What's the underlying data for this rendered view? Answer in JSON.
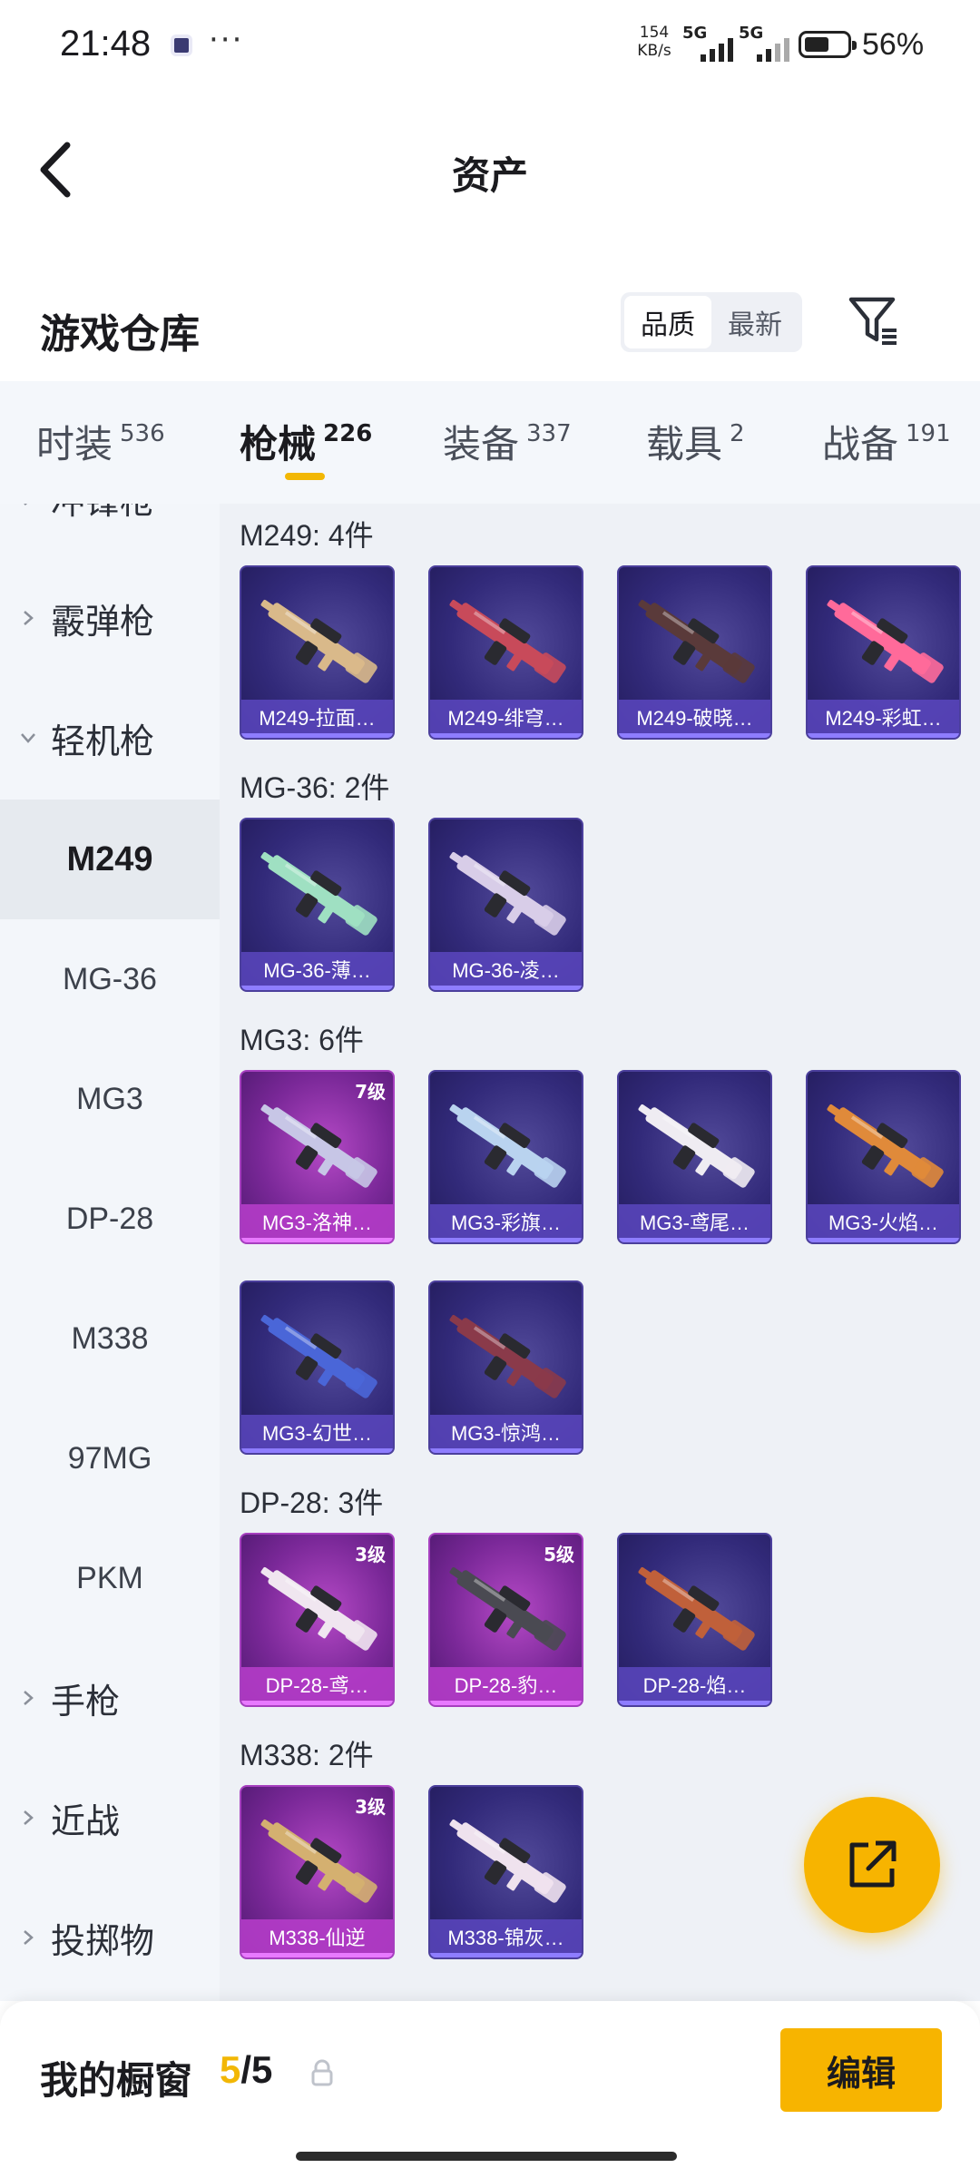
{
  "status_bar": {
    "time": "21:48",
    "dots": "···",
    "net_speed_value": "154",
    "net_speed_unit": "KB/s",
    "sig1_label": "5G",
    "sig2_label": "5G",
    "battery_level": 0.56,
    "battery_percent": "56%"
  },
  "header": {
    "title": "资产"
  },
  "warehouse": {
    "title": "游戏仓库",
    "sort_quality": "品质",
    "sort_newest": "最新"
  },
  "tabs": [
    {
      "label": "时装",
      "count": "536"
    },
    {
      "label": "枪械",
      "count": "226"
    },
    {
      "label": "装备",
      "count": "337"
    },
    {
      "label": "载具",
      "count": "2"
    },
    {
      "label": "战备",
      "count": "191"
    }
  ],
  "sidebar": {
    "items": [
      {
        "label": "冲锋枪"
      },
      {
        "label": "霰弹枪"
      },
      {
        "label": "轻机枪"
      },
      {
        "label": "M249"
      },
      {
        "label": "MG-36"
      },
      {
        "label": "MG3"
      },
      {
        "label": "DP-28"
      },
      {
        "label": "M338"
      },
      {
        "label": "97MG"
      },
      {
        "label": "PKM"
      },
      {
        "label": "手枪"
      },
      {
        "label": "近战"
      },
      {
        "label": "投掷物"
      }
    ]
  },
  "groups": [
    {
      "title": "M249: 4件",
      "items": [
        {
          "name": "M249-拉面…",
          "level": "",
          "gun_color": "#d9b98a"
        },
        {
          "name": "M249-绯穹…",
          "level": "",
          "gun_color": "#c84a5a"
        },
        {
          "name": "M249-破晓…",
          "level": "",
          "gun_color": "#5a3a3a"
        },
        {
          "name": "M249-彩虹…",
          "level": "",
          "gun_color": "#ff6a9a"
        }
      ]
    },
    {
      "title": "MG-36: 2件",
      "items": [
        {
          "name": "MG-36-薄…",
          "level": "",
          "gun_color": "#9fe0c2"
        },
        {
          "name": "MG-36-凌…",
          "level": "",
          "gun_color": "#d8cde8"
        }
      ]
    },
    {
      "title": "MG3: 6件",
      "items": [
        {
          "name": "MG3-洛神…",
          "level": "7级",
          "gun_color": "#c7c6e6"
        },
        {
          "name": "MG3-彩旗…",
          "level": "",
          "gun_color": "#b9d3ef"
        },
        {
          "name": "MG3-鸢尾…",
          "level": "",
          "gun_color": "#efecf2"
        },
        {
          "name": "MG3-火焰…",
          "level": "",
          "gun_color": "#e08a3a"
        },
        {
          "name": "MG3-幻世…",
          "level": "",
          "gun_color": "#4a66d8"
        },
        {
          "name": "MG3-惊鸿…",
          "level": "",
          "gun_color": "#8a3a4a"
        }
      ]
    },
    {
      "title": "DP-28: 3件",
      "items": [
        {
          "name": "DP-28-鸢…",
          "level": "3级",
          "gun_color": "#f0e6f0"
        },
        {
          "name": "DP-28-豹…",
          "level": "5级",
          "gun_color": "#4a4a52"
        },
        {
          "name": "DP-28-焰…",
          "level": "",
          "gun_color": "#c0603a"
        }
      ]
    },
    {
      "title": "M338: 2件",
      "items": [
        {
          "name": "M338-仙逆",
          "level": "3级",
          "gun_color": "#d4b070"
        },
        {
          "name": "M338-锦灰…",
          "level": "",
          "gun_color": "#efe2ee"
        }
      ]
    }
  ],
  "bottom": {
    "window_label": "我的橱窗",
    "window_current": "5",
    "window_sep_total": "/5",
    "edit_label": "编辑"
  },
  "colors": {
    "accent": "#f7b400",
    "card_blue": "#322a7a",
    "card_purple": "#7a2898"
  },
  "icons": {
    "back": "back-arrow-icon",
    "filter": "filter-icon",
    "share": "share-external-icon",
    "lock": "lock-icon"
  }
}
